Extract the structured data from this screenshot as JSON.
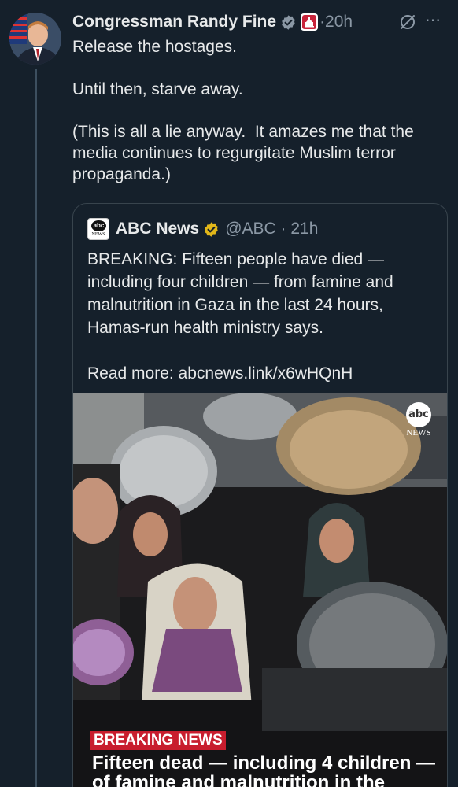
{
  "post": {
    "author": "Congressman Randy Fine",
    "time": "·20h",
    "text_lines": [
      "Release the hostages.",
      "",
      "Until then, starve away.",
      "",
      "(This is all a lie anyway.  It amazes me that the",
      "media continues to regurgitate Muslim terror",
      "propaganda.)"
    ],
    "more_icon": "⋯"
  },
  "quote": {
    "author": "ABC News",
    "handle": "@ABC · 21h",
    "logo_text": "abc",
    "logo_sub": "NEWS",
    "text_lines": [
      "BREAKING: Fifteen people have died —",
      "including four children — from famine and",
      "malnutrition in Gaza in the last 24 hours,",
      "Hamas-run health ministry says.",
      "",
      "Read more: abcnews.link/x6wHQnH"
    ],
    "media": {
      "badge_logo": "abc",
      "badge_sub": "NEWS",
      "breaking_label": "BREAKING NEWS",
      "headline": "Fifteen dead  — including 4 children — of famine and malnutrition in the"
    }
  },
  "colors": {
    "background": "#15202b",
    "verified_blue": "#1d9bf0",
    "gold_check": "#e2b719",
    "breaking_red": "#c81d2e"
  }
}
